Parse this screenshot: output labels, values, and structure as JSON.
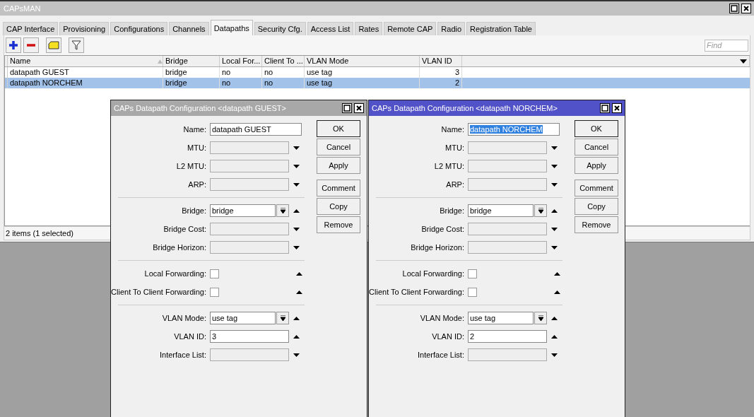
{
  "window": {
    "title": "CAPsMAN"
  },
  "tabs": [
    {
      "label": "CAP Interface",
      "selected": false
    },
    {
      "label": "Provisioning",
      "selected": false
    },
    {
      "label": "Configurations",
      "selected": false
    },
    {
      "label": "Channels",
      "selected": false
    },
    {
      "label": "Datapaths",
      "selected": true
    },
    {
      "label": "Security Cfg.",
      "selected": false
    },
    {
      "label": "Access List",
      "selected": false
    },
    {
      "label": "Rates",
      "selected": false
    },
    {
      "label": "Remote CAP",
      "selected": false
    },
    {
      "label": "Radio",
      "selected": false
    },
    {
      "label": "Registration Table",
      "selected": false
    }
  ],
  "search": {
    "placeholder": "Find"
  },
  "table": {
    "columns": [
      "Name",
      "Bridge",
      "Local For...",
      "Client To ...",
      "VLAN Mode",
      "VLAN ID"
    ],
    "rows": [
      {
        "cells": [
          "datapath GUEST",
          "bridge",
          "no",
          "no",
          "use tag",
          "3"
        ],
        "selected": false
      },
      {
        "cells": [
          "datapath NORCHEM",
          "bridge",
          "no",
          "no",
          "use tag",
          "2"
        ],
        "selected": true
      }
    ]
  },
  "status_bar": "2 items (1 selected)",
  "dialogs": [
    {
      "title": "CAPs Datapath Configuration <datapath GUEST>",
      "active": false,
      "sections": [
        [
          {
            "kind": "text",
            "label": "Name:",
            "value": "datapath GUEST",
            "highlighted": false
          },
          {
            "kind": "dropdown",
            "label": "MTU:"
          },
          {
            "kind": "dropdown",
            "label": "L2 MTU:"
          },
          {
            "kind": "dropdown",
            "label": "ARP:"
          }
        ],
        [
          {
            "kind": "select",
            "label": "Bridge:",
            "value": "bridge"
          },
          {
            "kind": "dropdown",
            "label": "Bridge Cost:"
          },
          {
            "kind": "dropdown",
            "label": "Bridge Horizon:"
          }
        ],
        [
          {
            "kind": "checkbox",
            "label": "Local Forwarding:",
            "checked": false
          },
          {
            "kind": "checkbox",
            "label": "Client To Client Forwarding:",
            "checked": false
          }
        ],
        [
          {
            "kind": "select",
            "label": "VLAN Mode:",
            "value": "use tag"
          },
          {
            "kind": "number",
            "label": "VLAN ID:",
            "value": "3"
          },
          {
            "kind": "dropdown",
            "label": "Interface List:"
          }
        ]
      ],
      "buttons": [
        "OK",
        "Cancel",
        "Apply",
        "Comment",
        "Copy",
        "Remove"
      ]
    },
    {
      "title": "CAPs Datapath Configuration <datapath NORCHEM>",
      "active": true,
      "sections": [
        [
          {
            "kind": "text",
            "label": "Name:",
            "value": "datapath NORCHEM",
            "highlighted": true
          },
          {
            "kind": "dropdown",
            "label": "MTU:"
          },
          {
            "kind": "dropdown",
            "label": "L2 MTU:"
          },
          {
            "kind": "dropdown",
            "label": "ARP:"
          }
        ],
        [
          {
            "kind": "select",
            "label": "Bridge:",
            "value": "bridge"
          },
          {
            "kind": "dropdown",
            "label": "Bridge Cost:"
          },
          {
            "kind": "dropdown",
            "label": "Bridge Horizon:"
          }
        ],
        [
          {
            "kind": "checkbox",
            "label": "Local Forwarding:",
            "checked": false
          },
          {
            "kind": "checkbox",
            "label": "Client To Client Forwarding:",
            "checked": false
          }
        ],
        [
          {
            "kind": "select",
            "label": "VLAN Mode:",
            "value": "use tag"
          },
          {
            "kind": "number",
            "label": "VLAN ID:",
            "value": "2"
          },
          {
            "kind": "dropdown",
            "label": "Interface List:"
          }
        ]
      ],
      "buttons": [
        "OK",
        "Cancel",
        "Apply",
        "Comment",
        "Copy",
        "Remove"
      ]
    }
  ]
}
